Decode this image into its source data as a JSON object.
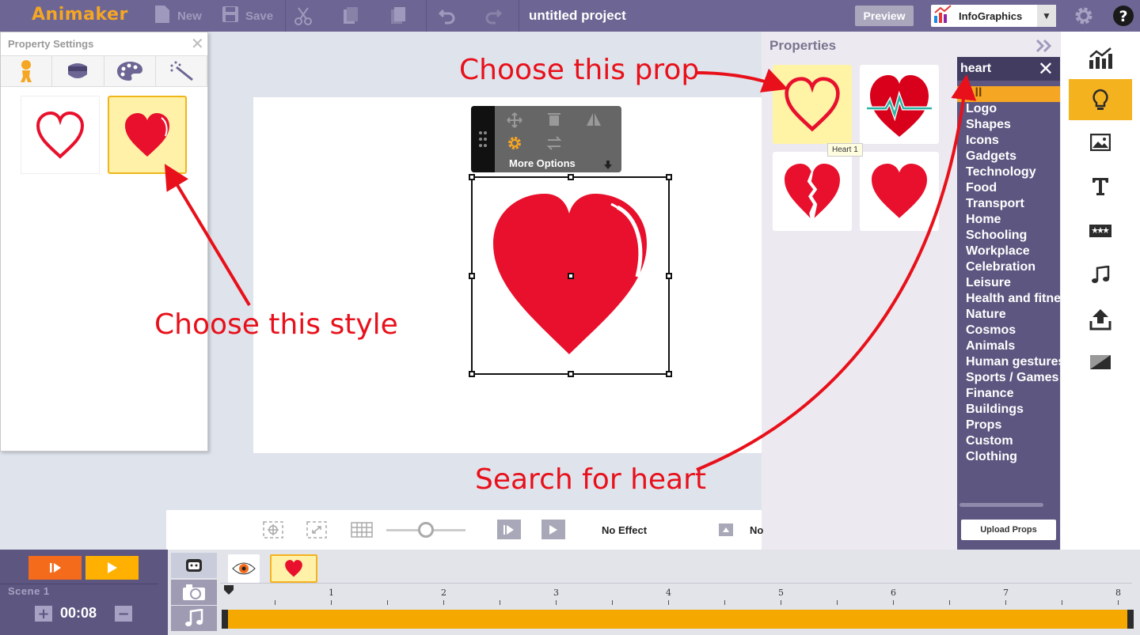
{
  "app": {
    "logo": "Animaker",
    "project_title": "untitled project"
  },
  "toolbar": {
    "new_label": "New",
    "save_label": "Save",
    "preview_label": "Preview",
    "template_select": "InfoGraphics"
  },
  "property_settings": {
    "title": "Property Settings",
    "tabs": [
      "person-icon",
      "face-icon",
      "palette-icon",
      "magic-wand-icon"
    ],
    "styles": [
      "heart-outline",
      "heart-filled"
    ],
    "selected_style": 1
  },
  "float_toolbar": {
    "more_options_label": "More Options"
  },
  "properties": {
    "title": "Properties",
    "items": [
      "heart-outline",
      "heart-pulse",
      "heart-broken",
      "heart-filled"
    ],
    "tooltip": "Heart 1",
    "search_value": "heart",
    "categories": [
      "All",
      "Logo",
      "Shapes",
      "Icons",
      "Gadgets",
      "Technology",
      "Food",
      "Transport",
      "Home",
      "Schooling",
      "Workplace",
      "Celebration",
      "Leisure",
      "Health and fitness",
      "Nature",
      "Cosmos",
      "Animals",
      "Human gestures",
      "Sports / Games",
      "Finance",
      "Buildings",
      "Props",
      "Custom",
      "Clothing"
    ],
    "active_category": "All",
    "upload_label": "Upload Props"
  },
  "bottom_controls": {
    "effect_label": "No Effect",
    "effect_label2": "No"
  },
  "timeline": {
    "scene_label": "Scene 1",
    "duration": "00:08",
    "ticks": [
      "1",
      "2",
      "3",
      "4",
      "5",
      "6",
      "7",
      "8"
    ]
  },
  "annotations": {
    "choose_prop": "Choose this prop",
    "choose_style": "Choose this style",
    "search_heart": "Search for heart"
  },
  "colors": {
    "accent": "#f5a623",
    "topbar": "#6d6593",
    "annotation": "#e8101a",
    "heart": "#e8102c"
  }
}
